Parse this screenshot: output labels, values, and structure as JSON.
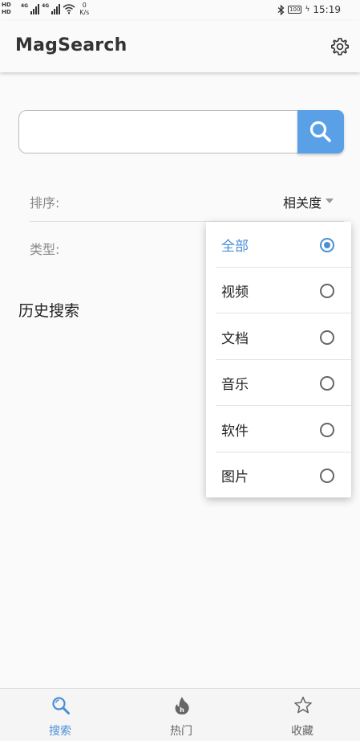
{
  "status_bar": {
    "hd_label": "HD",
    "lte_label": "4G",
    "net_speed_value": "0",
    "net_speed_unit": "K/s",
    "battery": "100",
    "time": "15:19"
  },
  "app_bar": {
    "title": "MagSearch",
    "settings_icon": "gear-icon"
  },
  "search": {
    "value": "",
    "placeholder": "",
    "button_icon": "search-icon",
    "accent": "#5aa0e6"
  },
  "filters": {
    "sort_label": "排序:",
    "sort_value": "相关度",
    "type_label": "类型:"
  },
  "history": {
    "title": "历史搜索"
  },
  "type_menu": {
    "selected_color": "#4a8fd6",
    "items": [
      {
        "label": "全部",
        "selected": true
      },
      {
        "label": "视频",
        "selected": false
      },
      {
        "label": "文档",
        "selected": false
      },
      {
        "label": "音乐",
        "selected": false
      },
      {
        "label": "软件",
        "selected": false
      },
      {
        "label": "图片",
        "selected": false
      }
    ]
  },
  "bottom_nav": {
    "items": [
      {
        "label": "搜索",
        "icon": "search-icon",
        "active": true
      },
      {
        "label": "热门",
        "icon": "flame-icon",
        "active": false
      },
      {
        "label": "收藏",
        "icon": "star-icon",
        "active": false
      }
    ]
  }
}
